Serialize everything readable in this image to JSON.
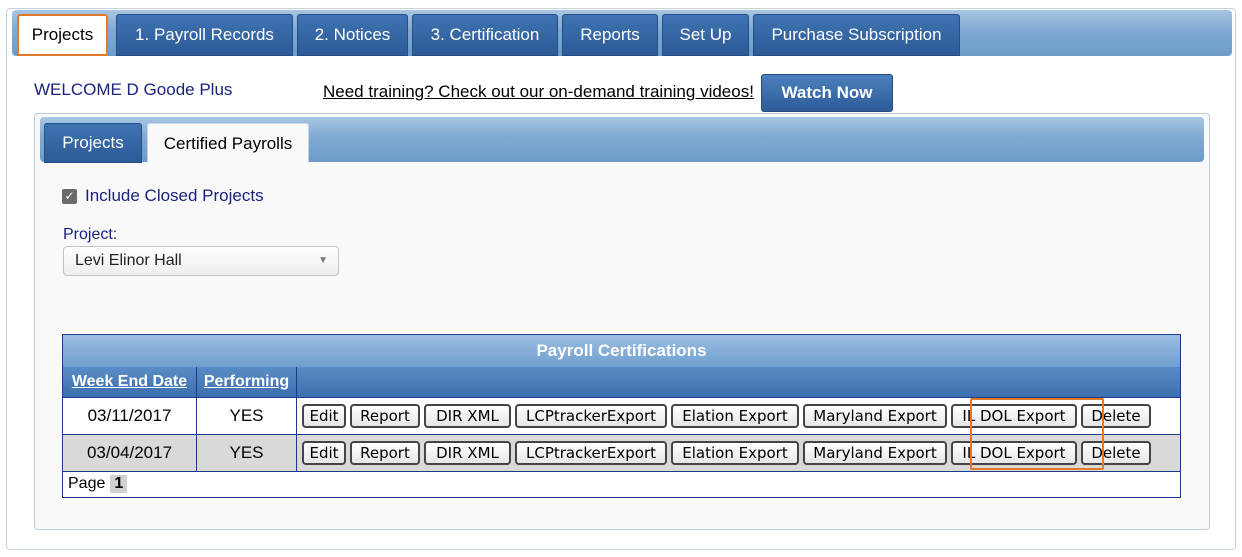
{
  "top_tabs": [
    "Projects",
    "1. Payroll Records",
    "2. Notices",
    "3. Certification",
    "Reports",
    "Set Up",
    "Purchase Subscription"
  ],
  "welcome": "WELCOME D Goode Plus",
  "training_link": "Need training? Check out our on-demand training videos!",
  "watch_now": "Watch Now",
  "inner_tabs": [
    "Projects",
    "Certified Payrolls"
  ],
  "include_closed": {
    "label": "Include Closed Projects",
    "checked": true
  },
  "project": {
    "label": "Project:",
    "selected": "Levi Elinor Hall"
  },
  "grid": {
    "title": "Payroll Certifications",
    "headers": [
      "Week End Date",
      "Performing"
    ],
    "rows": [
      {
        "date": "03/11/2017",
        "performing": "YES"
      },
      {
        "date": "03/04/2017",
        "performing": "YES"
      }
    ],
    "actions": [
      "Edit",
      "Report",
      "DIR XML",
      "LCPtrackerExport",
      "Elation Export",
      "Maryland Export",
      "IL DOL Export",
      "Delete"
    ],
    "page_label": "Page",
    "page_number": "1"
  },
  "colors": {
    "accent_highlight": "#e07a2a",
    "tab_blue": "#2c5b96",
    "link_navy": "#1a237e"
  }
}
